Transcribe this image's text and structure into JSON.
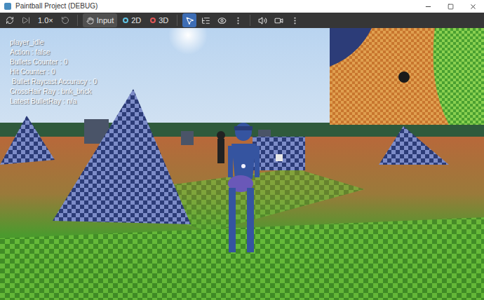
{
  "window": {
    "title": "Paintball Project (DEBUG)"
  },
  "toolbar": {
    "speed": "1.0×",
    "modes": [
      {
        "label": "Input",
        "selected": true,
        "kind": "input",
        "color": "#d8d8d8"
      },
      {
        "label": "2D",
        "selected": false,
        "kind": "view",
        "color": "#5fc3e4"
      },
      {
        "label": "3D",
        "selected": false,
        "kind": "view",
        "color": "#e05656"
      }
    ],
    "tools": [
      {
        "kind": "select",
        "selected": true
      },
      {
        "kind": "list",
        "selected": false
      },
      {
        "kind": "eye",
        "selected": false
      },
      {
        "kind": "more",
        "selected": false
      }
    ],
    "extras": [
      {
        "kind": "sound",
        "selected": false
      },
      {
        "kind": "camera",
        "selected": false
      },
      {
        "kind": "more",
        "selected": false
      }
    ]
  },
  "hud": {
    "lines": [
      "player_idle",
      "Action : false",
      "Bullets Counter : 0",
      "Hit Counter : 0",
      " Bullet Raycast Accuracy : 0",
      "CrossHair Ray : bnk_brick",
      "Latest BulletRay : n/a"
    ]
  }
}
